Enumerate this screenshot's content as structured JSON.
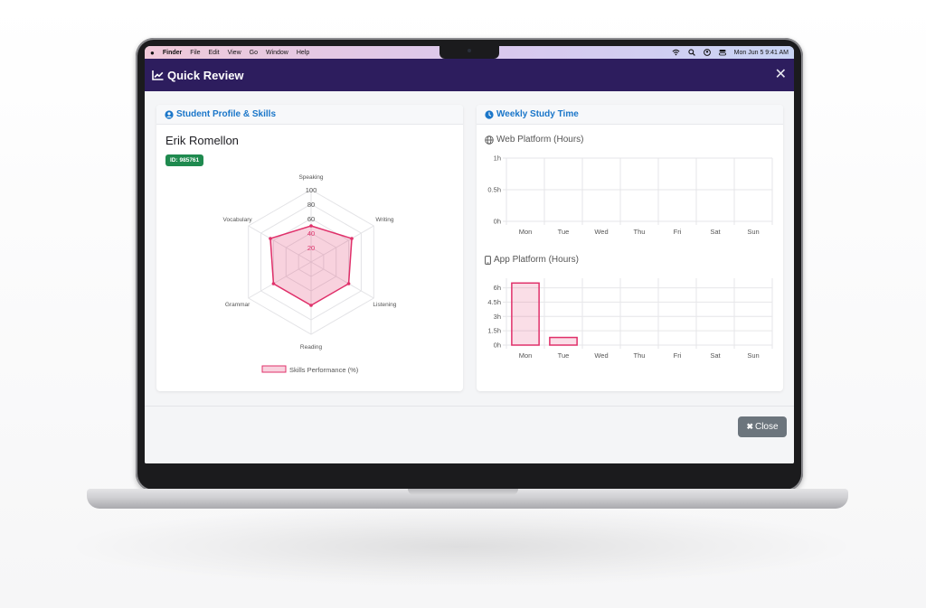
{
  "menubar": {
    "apple_icon": "apple-logo",
    "app_name": "Finder",
    "items": [
      "File",
      "Edit",
      "View",
      "Go",
      "Window",
      "Help"
    ],
    "status_icons": [
      "wifi-icon",
      "search-icon",
      "user-icon",
      "control-center-icon"
    ],
    "datetime": "Mon Jun 5  9:41 AM"
  },
  "modal": {
    "title": "Quick Review",
    "title_icon": "line-chart-icon",
    "close_button_label": "Close"
  },
  "profile_card": {
    "header": "Student Profile & Skills",
    "header_icon": "user-circle-icon",
    "student_name": "Erik Romellon",
    "student_id": "ID: 985761"
  },
  "study_card": {
    "header": "Weekly Study Time",
    "header_icon": "clock-icon",
    "web_title": "Web Platform (Hours)",
    "app_title": "App Platform (Hours)"
  },
  "colors": {
    "header_bg": "#2d1d5e",
    "accent_blue": "#1a76c9",
    "series_pink": "#e0306a",
    "badge_green": "#1f8a4f",
    "close_gray": "#6c757d"
  },
  "chart_data": [
    {
      "type": "radar",
      "axes": [
        "Speaking",
        "Writing",
        "Listening",
        "Reading",
        "Grammar",
        "Vocabulary"
      ],
      "rlim": [
        0,
        100
      ],
      "ticks": [
        "20",
        "40",
        "60",
        "80",
        "100"
      ],
      "series": [
        {
          "name": "Skills Performance (%)",
          "values": [
            50,
            65,
            60,
            60,
            60,
            65
          ]
        }
      ],
      "legend": "bottom"
    },
    {
      "type": "bar",
      "categories": [
        "Mon",
        "Tue",
        "Wed",
        "Thu",
        "Fri",
        "Sat",
        "Sun"
      ],
      "values": [
        0,
        0,
        0,
        0,
        0,
        0,
        0
      ],
      "ylim": [
        0,
        1
      ],
      "yticks": [
        {
          "label": "0h",
          "v": 0
        },
        {
          "label": "0.5h",
          "v": 0.5
        },
        {
          "label": "1h",
          "v": 1
        }
      ],
      "grid": true
    },
    {
      "type": "bar",
      "categories": [
        "Mon",
        "Tue",
        "Wed",
        "Thu",
        "Fri",
        "Sat",
        "Sun"
      ],
      "values": [
        6.5,
        0.8,
        0,
        0,
        0,
        0,
        0
      ],
      "ylim": [
        0,
        7
      ],
      "yticks": [
        {
          "label": "0h",
          "v": 0
        },
        {
          "label": "1.5h",
          "v": 1.5
        },
        {
          "label": "3h",
          "v": 3
        },
        {
          "label": "4.5h",
          "v": 4.5
        },
        {
          "label": "6h",
          "v": 6
        }
      ],
      "grid": true
    }
  ]
}
